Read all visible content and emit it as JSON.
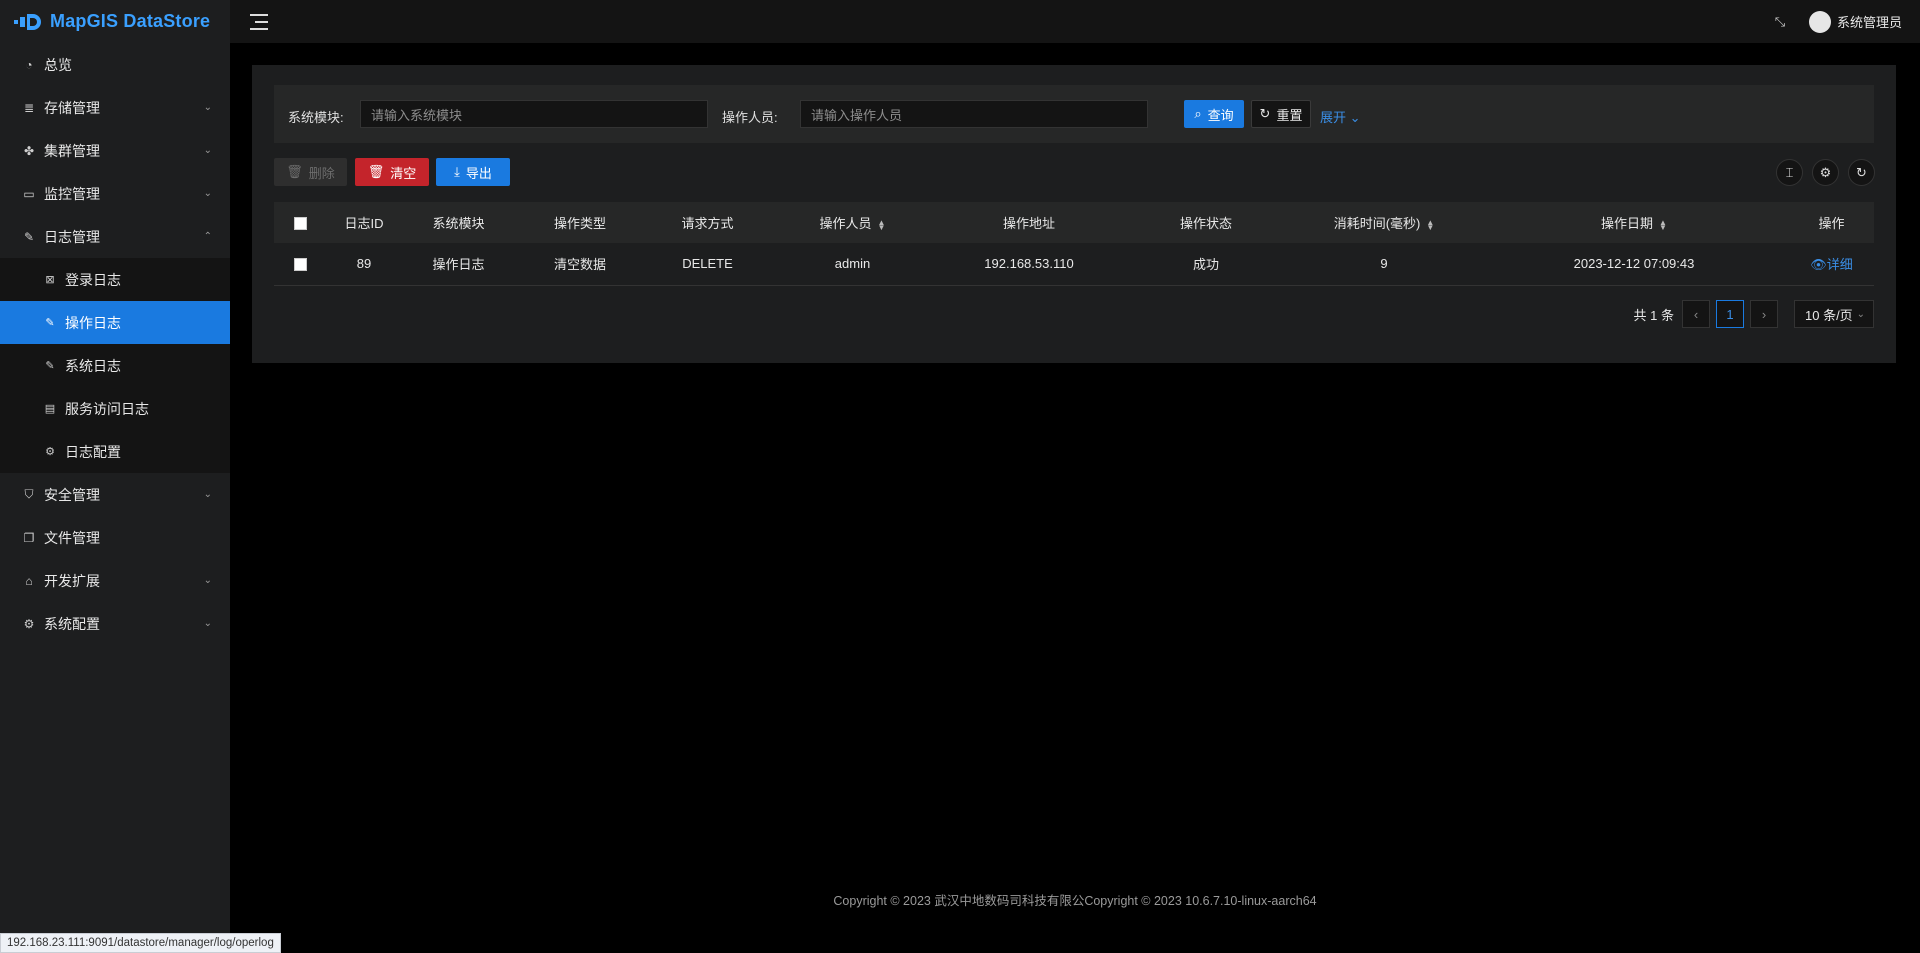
{
  "app": {
    "logo_text": "MapGIS DataStore"
  },
  "sidebar": {
    "items": [
      {
        "label": "总览",
        "icon": "dashboard-icon",
        "glyph": "◔"
      },
      {
        "label": "存储管理",
        "icon": "storage-icon",
        "glyph": "≣",
        "has_children": true
      },
      {
        "label": "集群管理",
        "icon": "cluster-icon",
        "glyph": "✤",
        "has_children": true
      },
      {
        "label": "监控管理",
        "icon": "monitor-icon",
        "glyph": "▭",
        "has_children": true
      },
      {
        "label": "日志管理",
        "icon": "log-icon",
        "glyph": "✎",
        "has_children": true,
        "expanded": true
      }
    ],
    "log_children": [
      {
        "label": "登录日志",
        "icon": "login-log-icon",
        "glyph": "⊠"
      },
      {
        "label": "操作日志",
        "icon": "operation-log-icon",
        "glyph": "✎",
        "active": true
      },
      {
        "label": "系统日志",
        "icon": "system-log-icon",
        "glyph": "✎"
      },
      {
        "label": "服务访问日志",
        "icon": "service-log-icon",
        "glyph": "▤"
      },
      {
        "label": "日志配置",
        "icon": "log-config-icon",
        "glyph": "⚙"
      }
    ],
    "items_after": [
      {
        "label": "安全管理",
        "icon": "shield-icon",
        "glyph": "⛉",
        "has_children": true
      },
      {
        "label": "文件管理",
        "icon": "file-icon",
        "glyph": "❐"
      },
      {
        "label": "开发扩展",
        "icon": "extension-icon",
        "glyph": "⌂",
        "has_children": true
      },
      {
        "label": "系统配置",
        "icon": "gear-icon",
        "glyph": "⚙",
        "has_children": true
      }
    ]
  },
  "header": {
    "user_name": "系统管理员"
  },
  "search": {
    "module_label": "系统模块:",
    "module_placeholder": "请输入系统模块",
    "operator_label": "操作人员:",
    "operator_placeholder": "请输入操作人员",
    "query_label": "查询",
    "reset_label": "重置",
    "expand_label": "展开"
  },
  "toolbar": {
    "delete_label": "删除",
    "clear_label": "清空",
    "export_label": "导出"
  },
  "table": {
    "columns": [
      "日志ID",
      "系统模块",
      "操作类型",
      "请求方式",
      "操作人员",
      "操作地址",
      "操作状态",
      "消耗时间(毫秒)",
      "操作日期",
      "操作"
    ],
    "rows": [
      [
        "89",
        "操作日志",
        "清空数据",
        "DELETE",
        "admin",
        "192.168.53.110",
        "成功",
        "9",
        "2023-12-12 07:09:43",
        "详细"
      ]
    ]
  },
  "pagination": {
    "total_text": "共 1 条",
    "current_page": "1",
    "page_size": "10 条/页"
  },
  "footer": {
    "copyright": "Copyright © 2023 武汉中地数码司科技有限公Copyright © 2023 10.6.7.10-linux-aarch64"
  },
  "statusbar": {
    "url": "192.168.23.111:9091/datastore/manager/log/operlog"
  },
  "colors": {
    "accent": "#1a7ae0",
    "danger": "#c4242b",
    "link": "#3a8ee6"
  }
}
